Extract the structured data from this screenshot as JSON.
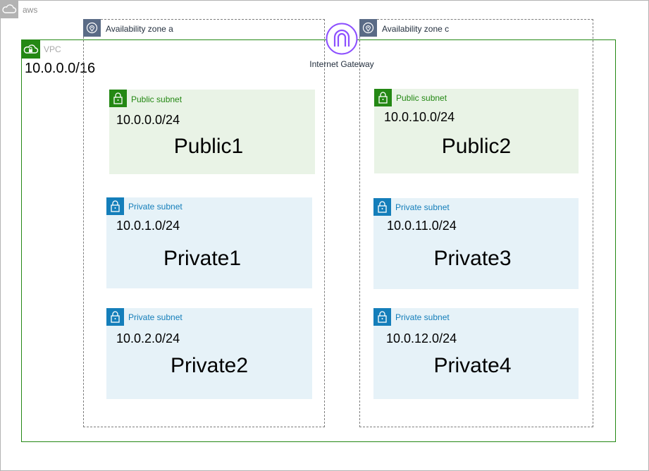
{
  "aws": {
    "label": "aws"
  },
  "vpc": {
    "label": "VPC",
    "cidr": "10.0.0.0/16"
  },
  "zones": [
    {
      "label": "Availability zone a"
    },
    {
      "label": "Availability zone c"
    }
  ],
  "gateway": {
    "label": "Internet Gateway"
  },
  "subnets": [
    {
      "type_label": "Public subnet",
      "cidr": "10.0.0.0/24",
      "name": "Public1"
    },
    {
      "type_label": "Public subnet",
      "cidr": "10.0.10.0/24",
      "name": "Public2"
    },
    {
      "type_label": "Private subnet",
      "cidr": "10.0.1.0/24",
      "name": "Private1"
    },
    {
      "type_label": "Private subnet",
      "cidr": "10.0.11.0/24",
      "name": "Private3"
    },
    {
      "type_label": "Private subnet",
      "cidr": "10.0.2.0/24",
      "name": "Private2"
    },
    {
      "type_label": "Private subnet",
      "cidr": "10.0.12.0/24",
      "name": "Private4"
    }
  ],
  "colors": {
    "vpc": "#248814",
    "public": "#248814",
    "private": "#147eba",
    "public_fill": "#e9f3e6",
    "private_fill": "#e6f2f8",
    "gateway": "#8c4fff",
    "zone_badge": "#5a6b86",
    "aws_badge": "#b3b3b3"
  },
  "icons": {
    "aws": "cloud-icon",
    "vpc": "vpc-cloud-lock-icon",
    "zone": "location-pin-icon",
    "gateway": "internet-gateway-icon",
    "subnet": "padlock-icon"
  }
}
